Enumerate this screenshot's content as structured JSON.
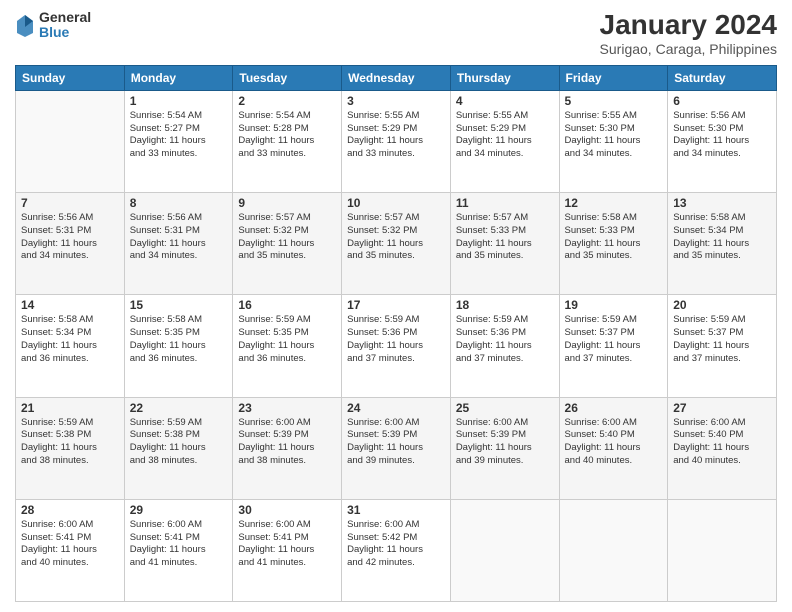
{
  "logo": {
    "general": "General",
    "blue": "Blue"
  },
  "title": "January 2024",
  "subtitle": "Surigao, Caraga, Philippines",
  "days_header": [
    "Sunday",
    "Monday",
    "Tuesday",
    "Wednesday",
    "Thursday",
    "Friday",
    "Saturday"
  ],
  "weeks": [
    [
      {
        "day": "",
        "info": ""
      },
      {
        "day": "1",
        "info": "Sunrise: 5:54 AM\nSunset: 5:27 PM\nDaylight: 11 hours\nand 33 minutes."
      },
      {
        "day": "2",
        "info": "Sunrise: 5:54 AM\nSunset: 5:28 PM\nDaylight: 11 hours\nand 33 minutes."
      },
      {
        "day": "3",
        "info": "Sunrise: 5:55 AM\nSunset: 5:29 PM\nDaylight: 11 hours\nand 33 minutes."
      },
      {
        "day": "4",
        "info": "Sunrise: 5:55 AM\nSunset: 5:29 PM\nDaylight: 11 hours\nand 34 minutes."
      },
      {
        "day": "5",
        "info": "Sunrise: 5:55 AM\nSunset: 5:30 PM\nDaylight: 11 hours\nand 34 minutes."
      },
      {
        "day": "6",
        "info": "Sunrise: 5:56 AM\nSunset: 5:30 PM\nDaylight: 11 hours\nand 34 minutes."
      }
    ],
    [
      {
        "day": "7",
        "info": "Sunrise: 5:56 AM\nSunset: 5:31 PM\nDaylight: 11 hours\nand 34 minutes."
      },
      {
        "day": "8",
        "info": "Sunrise: 5:56 AM\nSunset: 5:31 PM\nDaylight: 11 hours\nand 34 minutes."
      },
      {
        "day": "9",
        "info": "Sunrise: 5:57 AM\nSunset: 5:32 PM\nDaylight: 11 hours\nand 35 minutes."
      },
      {
        "day": "10",
        "info": "Sunrise: 5:57 AM\nSunset: 5:32 PM\nDaylight: 11 hours\nand 35 minutes."
      },
      {
        "day": "11",
        "info": "Sunrise: 5:57 AM\nSunset: 5:33 PM\nDaylight: 11 hours\nand 35 minutes."
      },
      {
        "day": "12",
        "info": "Sunrise: 5:58 AM\nSunset: 5:33 PM\nDaylight: 11 hours\nand 35 minutes."
      },
      {
        "day": "13",
        "info": "Sunrise: 5:58 AM\nSunset: 5:34 PM\nDaylight: 11 hours\nand 35 minutes."
      }
    ],
    [
      {
        "day": "14",
        "info": "Sunrise: 5:58 AM\nSunset: 5:34 PM\nDaylight: 11 hours\nand 36 minutes."
      },
      {
        "day": "15",
        "info": "Sunrise: 5:58 AM\nSunset: 5:35 PM\nDaylight: 11 hours\nand 36 minutes."
      },
      {
        "day": "16",
        "info": "Sunrise: 5:59 AM\nSunset: 5:35 PM\nDaylight: 11 hours\nand 36 minutes."
      },
      {
        "day": "17",
        "info": "Sunrise: 5:59 AM\nSunset: 5:36 PM\nDaylight: 11 hours\nand 37 minutes."
      },
      {
        "day": "18",
        "info": "Sunrise: 5:59 AM\nSunset: 5:36 PM\nDaylight: 11 hours\nand 37 minutes."
      },
      {
        "day": "19",
        "info": "Sunrise: 5:59 AM\nSunset: 5:37 PM\nDaylight: 11 hours\nand 37 minutes."
      },
      {
        "day": "20",
        "info": "Sunrise: 5:59 AM\nSunset: 5:37 PM\nDaylight: 11 hours\nand 37 minutes."
      }
    ],
    [
      {
        "day": "21",
        "info": "Sunrise: 5:59 AM\nSunset: 5:38 PM\nDaylight: 11 hours\nand 38 minutes."
      },
      {
        "day": "22",
        "info": "Sunrise: 5:59 AM\nSunset: 5:38 PM\nDaylight: 11 hours\nand 38 minutes."
      },
      {
        "day": "23",
        "info": "Sunrise: 6:00 AM\nSunset: 5:39 PM\nDaylight: 11 hours\nand 38 minutes."
      },
      {
        "day": "24",
        "info": "Sunrise: 6:00 AM\nSunset: 5:39 PM\nDaylight: 11 hours\nand 39 minutes."
      },
      {
        "day": "25",
        "info": "Sunrise: 6:00 AM\nSunset: 5:39 PM\nDaylight: 11 hours\nand 39 minutes."
      },
      {
        "day": "26",
        "info": "Sunrise: 6:00 AM\nSunset: 5:40 PM\nDaylight: 11 hours\nand 40 minutes."
      },
      {
        "day": "27",
        "info": "Sunrise: 6:00 AM\nSunset: 5:40 PM\nDaylight: 11 hours\nand 40 minutes."
      }
    ],
    [
      {
        "day": "28",
        "info": "Sunrise: 6:00 AM\nSunset: 5:41 PM\nDaylight: 11 hours\nand 40 minutes."
      },
      {
        "day": "29",
        "info": "Sunrise: 6:00 AM\nSunset: 5:41 PM\nDaylight: 11 hours\nand 41 minutes."
      },
      {
        "day": "30",
        "info": "Sunrise: 6:00 AM\nSunset: 5:41 PM\nDaylight: 11 hours\nand 41 minutes."
      },
      {
        "day": "31",
        "info": "Sunrise: 6:00 AM\nSunset: 5:42 PM\nDaylight: 11 hours\nand 42 minutes."
      },
      {
        "day": "",
        "info": ""
      },
      {
        "day": "",
        "info": ""
      },
      {
        "day": "",
        "info": ""
      }
    ]
  ]
}
